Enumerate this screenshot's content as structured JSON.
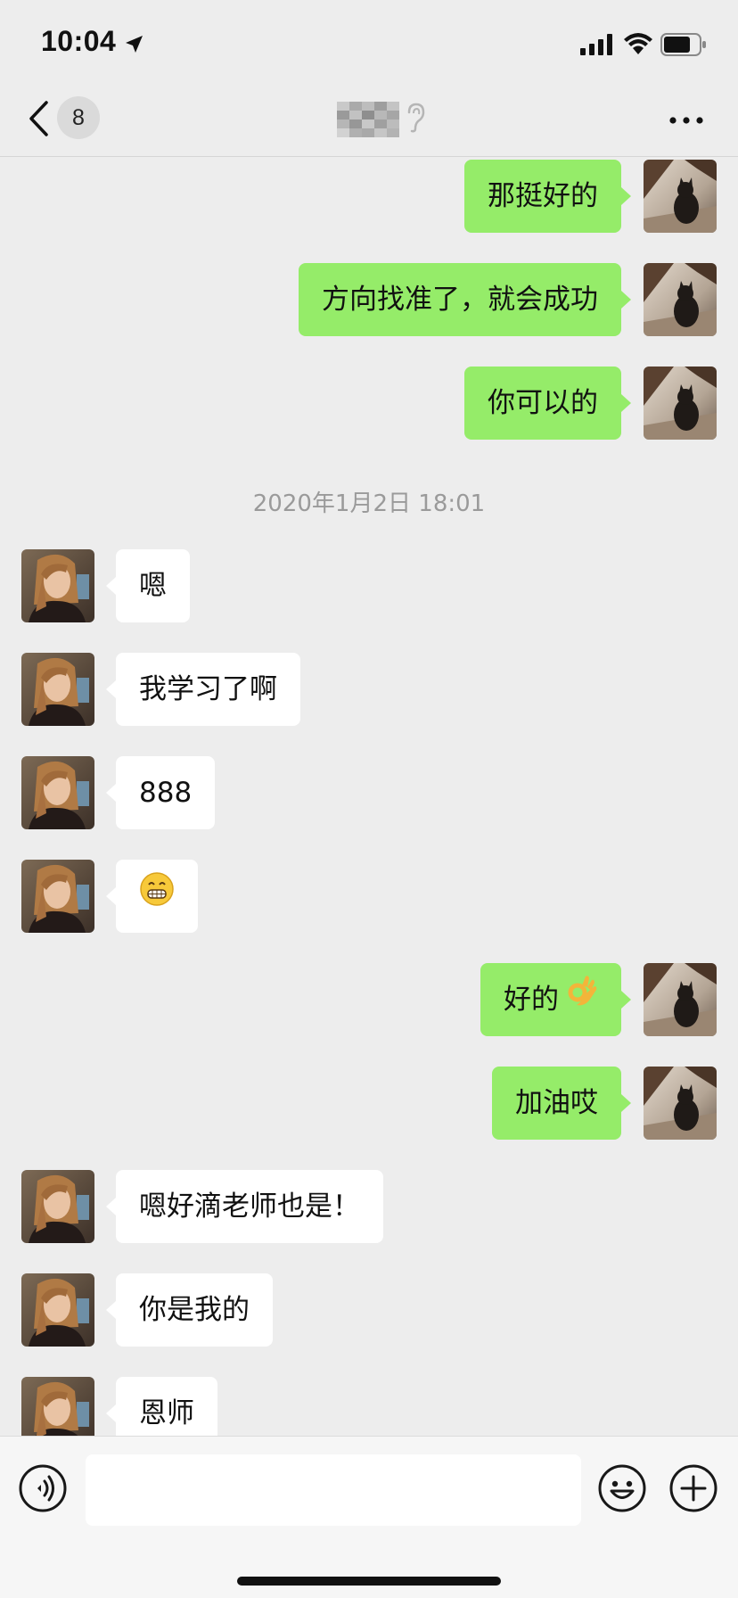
{
  "status_bar": {
    "time": "10:04",
    "icons": [
      "location-arrow-icon",
      "cellular-signal-icon",
      "wifi-icon",
      "battery-icon"
    ]
  },
  "nav": {
    "unread_count": "8",
    "title_is_mosaic": true,
    "icons": [
      "back-chevron-icon",
      "ear-icon",
      "more-icon"
    ]
  },
  "messages": [
    {
      "side": "right",
      "text": "那挺好的"
    },
    {
      "side": "right",
      "text": "方向找准了，就会成功"
    },
    {
      "side": "right",
      "text": "你可以的"
    },
    {
      "type": "timestamp",
      "text": "2020年1月2日 18:01"
    },
    {
      "side": "left",
      "text": "嗯"
    },
    {
      "side": "left",
      "text": "我学习了啊"
    },
    {
      "side": "left",
      "text": "888"
    },
    {
      "side": "left",
      "emoji": "grinning-face-emoji"
    },
    {
      "side": "right",
      "text": "好的",
      "emoji": "ok-hand-emoji"
    },
    {
      "side": "right",
      "text": "加油哎"
    },
    {
      "side": "left",
      "text": "嗯好滴老师也是！"
    },
    {
      "side": "left",
      "text": "你是我的"
    },
    {
      "side": "left",
      "text": "恩师"
    }
  ],
  "input_bar": {
    "placeholder": "",
    "icons": [
      "voice-icon",
      "emoji-icon",
      "plus-icon"
    ]
  },
  "colors": {
    "background": "#ededed",
    "sent_bubble": "#95ec69",
    "received_bubble": "#ffffff",
    "timestamp_text": "#9a9a9a"
  }
}
